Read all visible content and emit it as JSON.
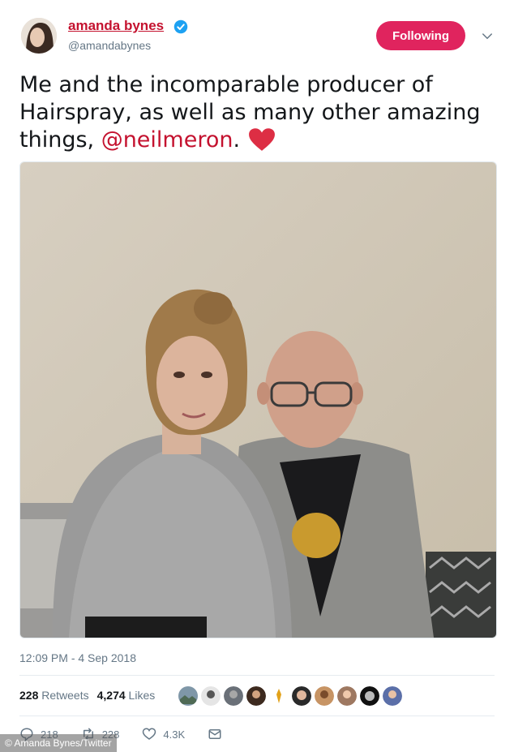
{
  "user": {
    "display_name": "amanda bynes",
    "handle": "@amandabynes",
    "verified": true,
    "follow_button_label": "Following"
  },
  "tweet": {
    "text_main": "Me and the incomparable producer of Hairspray, as well as many other amazing things, ",
    "mention": "@neilmeron",
    "text_end": ".",
    "emoji": "red-heart"
  },
  "meta": {
    "timestamp": "12:09 PM - 4 Sep 2018",
    "retweets_count": "228",
    "retweets_label": "Retweets",
    "likes_count": "4,274",
    "likes_label": "Likes"
  },
  "actions": {
    "reply_count": "218",
    "retweet_count": "228",
    "like_count": "4.3K"
  },
  "photo_credit": "© Amanda Bynes/Twitter",
  "colors": {
    "accent": "#c4122f",
    "follow_button": "#e0245e",
    "verified": "#1da1f2",
    "muted_text": "#657786"
  }
}
